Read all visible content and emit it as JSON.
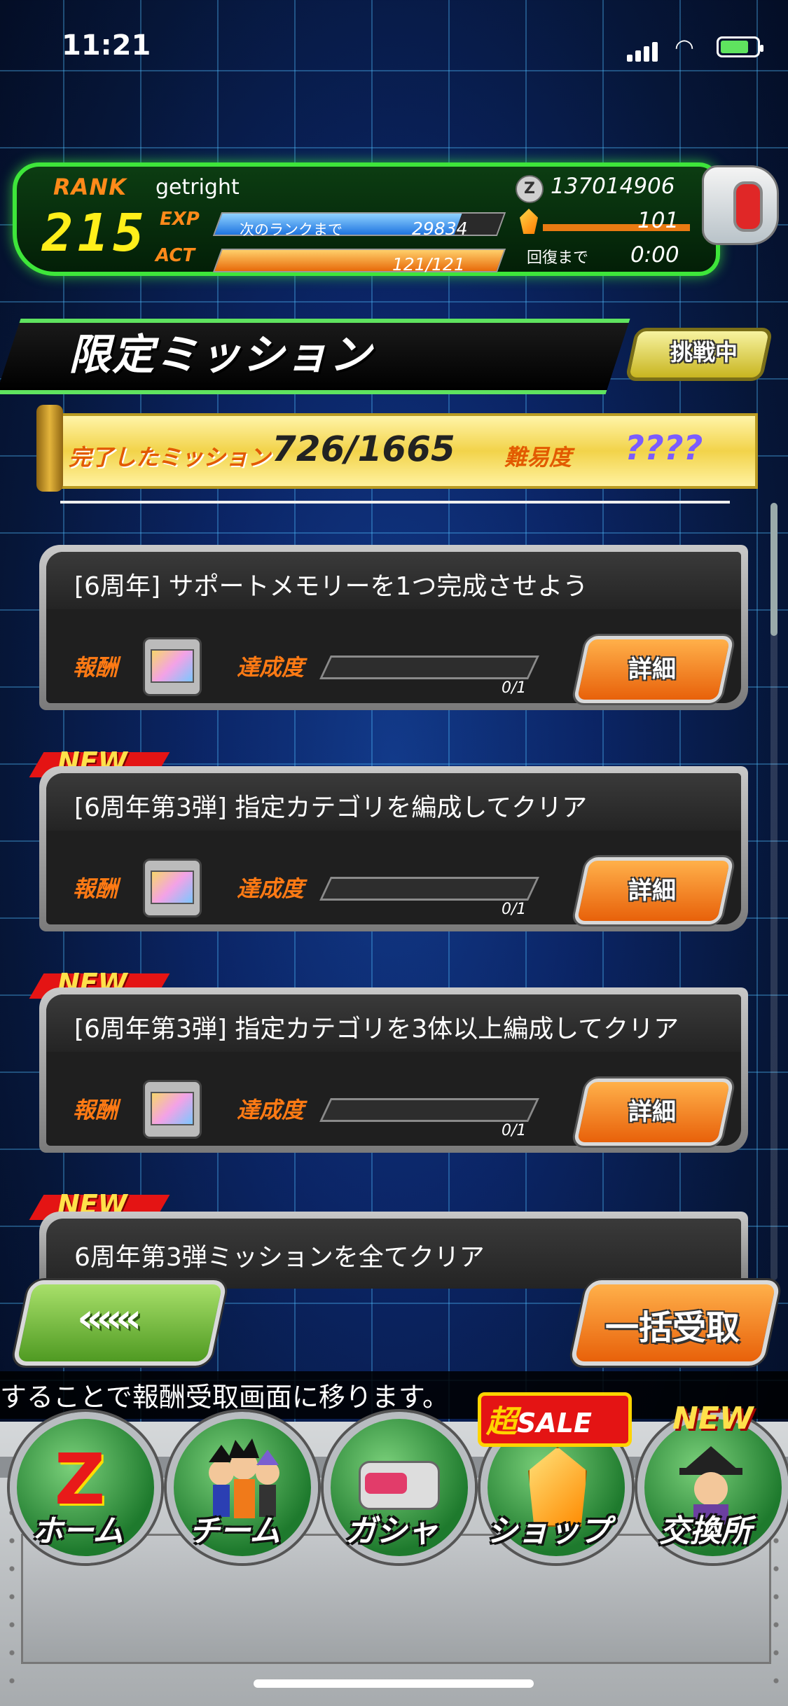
{
  "status_bar": {
    "time": "11:21"
  },
  "player": {
    "rank_label": "RANK",
    "rank": "215",
    "name": "getright",
    "exp_label": "EXP",
    "exp_sub": "次のランクまで",
    "exp_to_next": "29834",
    "exp_fill": 0.85,
    "act_label": "ACT",
    "act": "121/121",
    "act_fill": 1.0,
    "zeni_icon": "Z",
    "zeni": "137014906",
    "dragon_stones": "101",
    "recover_label": "回復まで",
    "recover_time": "0:00"
  },
  "header": {
    "title": "限定ミッション",
    "challenge_label": "挑戦中"
  },
  "summary": {
    "completed_label": "完了したミッション",
    "completed": "726/1665",
    "difficulty_label": "難易度",
    "difficulty": "????"
  },
  "missions": [
    {
      "title": "[6周年] サポートメモリーを1つ完成させよう",
      "reward_label": "報酬",
      "progress_label": "達成度",
      "progress": "0/1",
      "detail_label": "詳細",
      "new": false
    },
    {
      "title": "[6周年第3弾] 指定カテゴリを編成してクリア",
      "reward_label": "報酬",
      "progress_label": "達成度",
      "progress": "0/1",
      "detail_label": "詳細",
      "new": true,
      "new_label": "NEW"
    },
    {
      "title": "[6周年第3弾] 指定カテゴリを3体以上編成してクリア",
      "reward_label": "報酬",
      "progress_label": "達成度",
      "progress": "0/1",
      "detail_label": "詳細",
      "new": true,
      "new_label": "NEW"
    },
    {
      "title": "6周年第3弾ミッションを全てクリア",
      "new": true,
      "new_label": "NEW"
    }
  ],
  "actions": {
    "back_label": "«««",
    "receive_all_label": "一括受取"
  },
  "ticker": "することで報酬受取画面に移ります。",
  "nav": {
    "items": [
      {
        "label": "ホーム",
        "icon": "dragon-z-icon"
      },
      {
        "label": "チーム",
        "icon": "team-characters-icon"
      },
      {
        "label": "ガシャ",
        "icon": "scouter-gacha-icon"
      },
      {
        "label": "ショップ",
        "icon": "dragon-stone-icon"
      },
      {
        "label": "交換所",
        "icon": "exchange-shop-icon"
      }
    ],
    "sale_prefix": "超",
    "sale_label": "SALE",
    "exchange_new": "NEW"
  },
  "colors": {
    "accent_green": "#3ee63a",
    "accent_orange": "#ff7a14",
    "rank_yellow": "#ffef1a",
    "new_red": "#e41414"
  }
}
